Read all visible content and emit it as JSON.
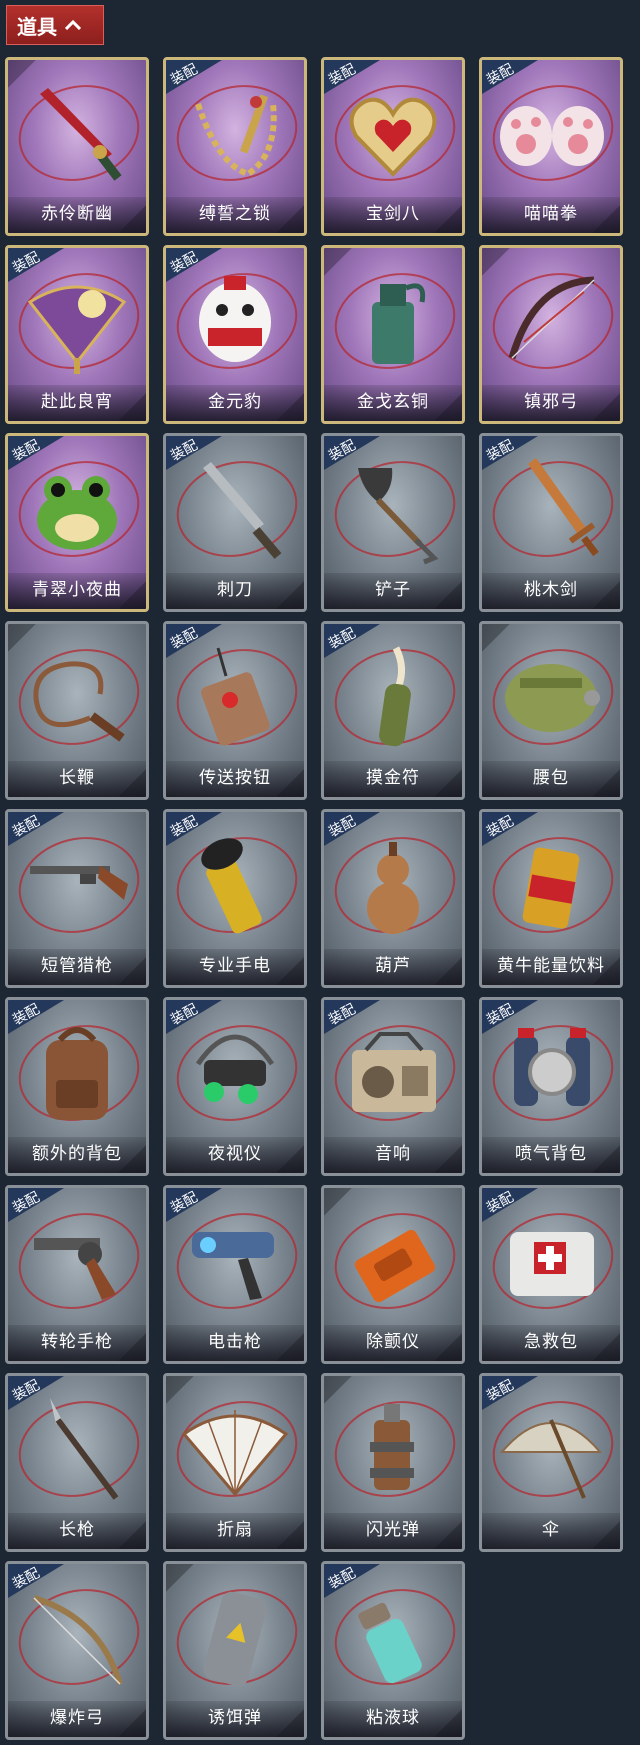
{
  "header": {
    "title": "道具"
  },
  "badge_text": "装配",
  "items": [
    {
      "name": "赤伶断幽",
      "equipped": false,
      "rarity": "gold",
      "icon": "dagger-icon"
    },
    {
      "name": "缚誓之锁",
      "equipped": true,
      "rarity": "gold",
      "icon": "chain-icon"
    },
    {
      "name": "宝剑八",
      "equipped": true,
      "rarity": "gold",
      "icon": "heart-shield-icon"
    },
    {
      "name": "喵喵拳",
      "equipped": true,
      "rarity": "gold",
      "icon": "cat-paw-icon"
    },
    {
      "name": "赴此良宵",
      "equipped": true,
      "rarity": "gold",
      "icon": "fan-icon"
    },
    {
      "name": "金元豹",
      "equipped": true,
      "rarity": "gold",
      "icon": "mascot-icon"
    },
    {
      "name": "金戈玄铜",
      "equipped": false,
      "rarity": "gold",
      "icon": "bronze-grenade-icon"
    },
    {
      "name": "镇邪弓",
      "equipped": false,
      "rarity": "gold",
      "icon": "bow-icon"
    },
    {
      "name": "青翠小夜曲",
      "equipped": true,
      "rarity": "gold",
      "icon": "frog-icon"
    },
    {
      "name": "刺刀",
      "equipped": true,
      "rarity": "silver",
      "icon": "bayonet-icon"
    },
    {
      "name": "铲子",
      "equipped": true,
      "rarity": "silver",
      "icon": "shovel-icon"
    },
    {
      "name": "桃木剑",
      "equipped": true,
      "rarity": "silver",
      "icon": "wooden-sword-icon"
    },
    {
      "name": "长鞭",
      "equipped": false,
      "rarity": "silver",
      "icon": "whip-icon"
    },
    {
      "name": "传送按钮",
      "equipped": true,
      "rarity": "silver",
      "icon": "remote-icon"
    },
    {
      "name": "摸金符",
      "equipped": true,
      "rarity": "silver",
      "icon": "talisman-icon"
    },
    {
      "name": "腰包",
      "equipped": false,
      "rarity": "silver",
      "icon": "waist-bag-icon"
    },
    {
      "name": "短管猎枪",
      "equipped": true,
      "rarity": "silver",
      "icon": "shotgun-icon"
    },
    {
      "name": "专业手电",
      "equipped": true,
      "rarity": "silver",
      "icon": "flashlight-icon"
    },
    {
      "name": "葫芦",
      "equipped": true,
      "rarity": "silver",
      "icon": "gourd-icon"
    },
    {
      "name": "黄牛能量饮料",
      "equipped": true,
      "rarity": "silver",
      "icon": "energy-can-icon"
    },
    {
      "name": "额外的背包",
      "equipped": true,
      "rarity": "silver",
      "icon": "backpack-icon"
    },
    {
      "name": "夜视仪",
      "equipped": true,
      "rarity": "silver",
      "icon": "night-goggles-icon"
    },
    {
      "name": "音响",
      "equipped": true,
      "rarity": "silver",
      "icon": "radio-icon"
    },
    {
      "name": "喷气背包",
      "equipped": true,
      "rarity": "silver",
      "icon": "jetpack-icon"
    },
    {
      "name": "转轮手枪",
      "equipped": true,
      "rarity": "silver",
      "icon": "revolver-icon"
    },
    {
      "name": "电击枪",
      "equipped": true,
      "rarity": "silver",
      "icon": "shock-gun-icon"
    },
    {
      "name": "除颤仪",
      "equipped": false,
      "rarity": "silver",
      "icon": "defibrillator-icon"
    },
    {
      "name": "急救包",
      "equipped": true,
      "rarity": "silver",
      "icon": "first-aid-icon"
    },
    {
      "name": "长枪",
      "equipped": true,
      "rarity": "silver",
      "icon": "spear-icon"
    },
    {
      "name": "折扇",
      "equipped": false,
      "rarity": "silver",
      "icon": "folding-fan-icon"
    },
    {
      "name": "闪光弹",
      "equipped": false,
      "rarity": "silver",
      "icon": "flashbang-icon"
    },
    {
      "name": "伞",
      "equipped": true,
      "rarity": "silver",
      "icon": "umbrella-icon"
    },
    {
      "name": "爆炸弓",
      "equipped": true,
      "rarity": "silver",
      "icon": "explosive-bow-icon"
    },
    {
      "name": "诱饵弹",
      "equipped": false,
      "rarity": "silver",
      "icon": "decoy-icon"
    },
    {
      "name": "粘液球",
      "equipped": true,
      "rarity": "silver",
      "icon": "slime-jar-icon"
    }
  ]
}
